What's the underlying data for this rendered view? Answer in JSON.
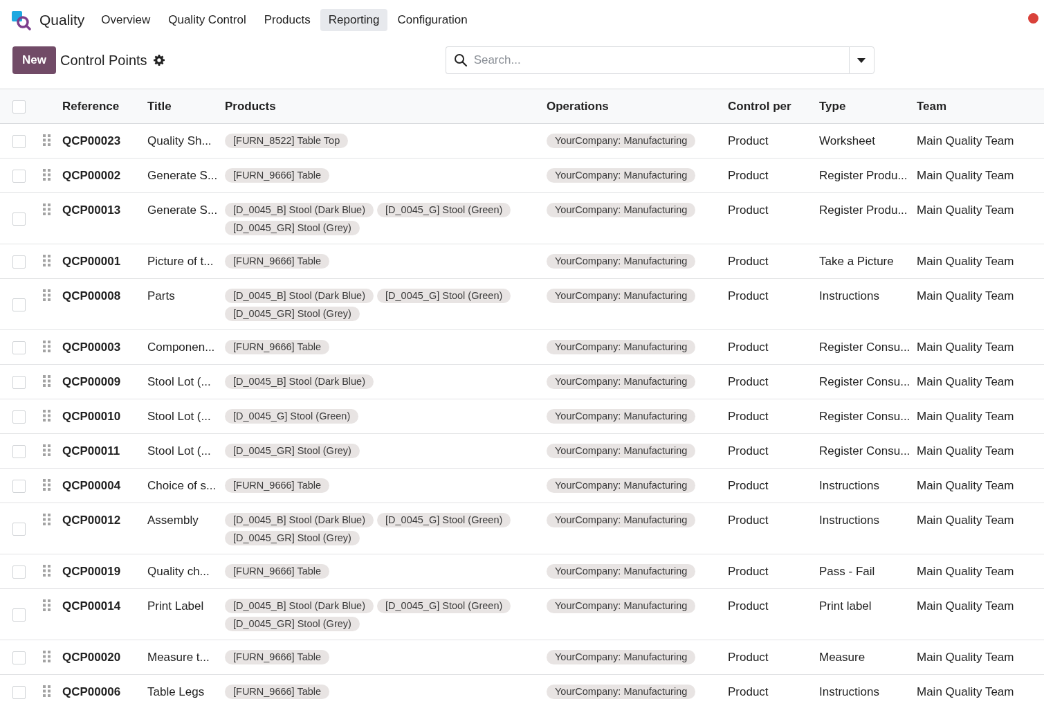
{
  "app": {
    "name": "Quality",
    "notification": true
  },
  "nav": [
    {
      "label": "Overview",
      "selected": false
    },
    {
      "label": "Quality Control",
      "selected": false
    },
    {
      "label": "Products",
      "selected": false
    },
    {
      "label": "Reporting",
      "selected": true
    },
    {
      "label": "Configuration",
      "selected": false
    }
  ],
  "control_bar": {
    "new_button": "New",
    "title": "Control Points",
    "search": {
      "placeholder": "Search..."
    }
  },
  "table": {
    "select_all": {
      "checked": false
    },
    "columns": [
      "Reference",
      "Title",
      "Products",
      "Operations",
      "Control per",
      "Type",
      "Team"
    ],
    "rows": [
      {
        "selected": false,
        "reference": "QCP00023",
        "title": "Quality Sh...",
        "products": [
          "[FURN_8522] Table Top"
        ],
        "operations": [
          "YourCompany: Manufacturing"
        ],
        "control_per": "Product",
        "type": "Worksheet",
        "team": "Main Quality Team"
      },
      {
        "selected": false,
        "reference": "QCP00002",
        "title": "Generate S...",
        "products": [
          "[FURN_9666] Table"
        ],
        "operations": [
          "YourCompany: Manufacturing"
        ],
        "control_per": "Product",
        "type": "Register Produ...",
        "team": "Main Quality Team"
      },
      {
        "selected": false,
        "reference": "QCP00013",
        "title": "Generate S...",
        "products": [
          "[D_0045_B] Stool (Dark Blue)",
          "[D_0045_G] Stool (Green)",
          "[D_0045_GR] Stool (Grey)"
        ],
        "operations": [
          "YourCompany: Manufacturing"
        ],
        "control_per": "Product",
        "type": "Register Produ...",
        "team": "Main Quality Team"
      },
      {
        "selected": false,
        "reference": "QCP00001",
        "title": "Picture of t...",
        "products": [
          "[FURN_9666] Table"
        ],
        "operations": [
          "YourCompany: Manufacturing"
        ],
        "control_per": "Product",
        "type": "Take a Picture",
        "team": "Main Quality Team"
      },
      {
        "selected": false,
        "reference": "QCP00008",
        "title": "Parts",
        "products": [
          "[D_0045_B] Stool (Dark Blue)",
          "[D_0045_G] Stool (Green)",
          "[D_0045_GR] Stool (Grey)"
        ],
        "operations": [
          "YourCompany: Manufacturing"
        ],
        "control_per": "Product",
        "type": "Instructions",
        "team": "Main Quality Team"
      },
      {
        "selected": false,
        "reference": "QCP00003",
        "title": "Componen...",
        "products": [
          "[FURN_9666] Table"
        ],
        "operations": [
          "YourCompany: Manufacturing"
        ],
        "control_per": "Product",
        "type": "Register Consu...",
        "team": "Main Quality Team"
      },
      {
        "selected": false,
        "reference": "QCP00009",
        "title": "Stool Lot (...",
        "products": [
          "[D_0045_B] Stool (Dark Blue)"
        ],
        "operations": [
          "YourCompany: Manufacturing"
        ],
        "control_per": "Product",
        "type": "Register Consu...",
        "team": "Main Quality Team"
      },
      {
        "selected": false,
        "reference": "QCP00010",
        "title": "Stool Lot (...",
        "products": [
          "[D_0045_G] Stool (Green)"
        ],
        "operations": [
          "YourCompany: Manufacturing"
        ],
        "control_per": "Product",
        "type": "Register Consu...",
        "team": "Main Quality Team"
      },
      {
        "selected": false,
        "reference": "QCP00011",
        "title": "Stool Lot (...",
        "products": [
          "[D_0045_GR] Stool (Grey)"
        ],
        "operations": [
          "YourCompany: Manufacturing"
        ],
        "control_per": "Product",
        "type": "Register Consu...",
        "team": "Main Quality Team"
      },
      {
        "selected": false,
        "reference": "QCP00004",
        "title": "Choice of s...",
        "products": [
          "[FURN_9666] Table"
        ],
        "operations": [
          "YourCompany: Manufacturing"
        ],
        "control_per": "Product",
        "type": "Instructions",
        "team": "Main Quality Team"
      },
      {
        "selected": false,
        "reference": "QCP00012",
        "title": "Assembly",
        "products": [
          "[D_0045_B] Stool (Dark Blue)",
          "[D_0045_G] Stool (Green)",
          "[D_0045_GR] Stool (Grey)"
        ],
        "operations": [
          "YourCompany: Manufacturing"
        ],
        "control_per": "Product",
        "type": "Instructions",
        "team": "Main Quality Team"
      },
      {
        "selected": false,
        "reference": "QCP00019",
        "title": "Quality ch...",
        "products": [
          "[FURN_9666] Table"
        ],
        "operations": [
          "YourCompany: Manufacturing"
        ],
        "control_per": "Product",
        "type": "Pass - Fail",
        "team": "Main Quality Team"
      },
      {
        "selected": false,
        "reference": "QCP00014",
        "title": "Print Label",
        "products": [
          "[D_0045_B] Stool (Dark Blue)",
          "[D_0045_G] Stool (Green)",
          "[D_0045_GR] Stool (Grey)"
        ],
        "operations": [
          "YourCompany: Manufacturing"
        ],
        "control_per": "Product",
        "type": "Print label",
        "team": "Main Quality Team"
      },
      {
        "selected": false,
        "reference": "QCP00020",
        "title": "Measure t...",
        "products": [
          "[FURN_9666] Table"
        ],
        "operations": [
          "YourCompany: Manufacturing"
        ],
        "control_per": "Product",
        "type": "Measure",
        "team": "Main Quality Team"
      },
      {
        "selected": false,
        "reference": "QCP00006",
        "title": "Table Legs",
        "products": [
          "[FURN_9666] Table"
        ],
        "operations": [
          "YourCompany: Manufacturing"
        ],
        "control_per": "Product",
        "type": "Instructions",
        "team": "Main Quality Team"
      }
    ]
  }
}
